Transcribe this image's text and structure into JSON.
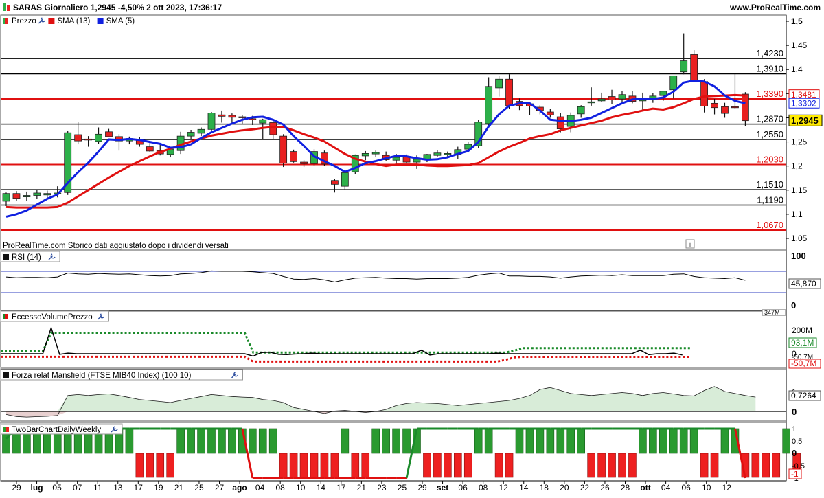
{
  "header": {
    "title": "SARAS Giornaliero 1,2945 -4,50% 2 ott 2023, 17:36:17",
    "site": "www.ProRealTime.com",
    "note": "ProRealTime.com  Storico dati aggiustato dopo i dividendi versati",
    "info_glyph": "i"
  },
  "colors": {
    "up": "#2db04a",
    "down": "#e82020",
    "sma13": "#e01010",
    "sma5": "#1020e0",
    "level_black": "#000000",
    "level_red": "#e01010",
    "mansfield_fill": "#d8ecd8",
    "mansfield_neg_fill": "#e8d0d0"
  },
  "price_panel": {
    "legend": [
      {
        "label": "Prezzo",
        "color": "#2db04a",
        "icon": "candle-icon"
      },
      {
        "label": "SMA (13)",
        "color": "#e01010",
        "icon": "wrench-icon"
      },
      {
        "label": "SMA (5)",
        "color": "#1020e0",
        "icon": "wrench-icon"
      }
    ],
    "y_ticks": [
      "1,5",
      "1,45",
      "1,4",
      "1,35",
      "1,3",
      "1,25",
      "1,2",
      "1,15",
      "1,1",
      "1,05"
    ],
    "levels": [
      {
        "value": 1.423,
        "label": "1,4230",
        "color": "black"
      },
      {
        "value": 1.391,
        "label": "1,3910",
        "color": "black"
      },
      {
        "value": 1.339,
        "label": "1,3390",
        "color": "red"
      },
      {
        "value": 1.287,
        "label": "1,2870",
        "color": "black"
      },
      {
        "value": 1.255,
        "label": "1,2550",
        "color": "black"
      },
      {
        "value": 1.203,
        "label": "1,2030",
        "color": "red"
      },
      {
        "value": 1.151,
        "label": "1,1510",
        "color": "black"
      },
      {
        "value": 1.119,
        "label": "1,1190",
        "color": "black"
      },
      {
        "value": 1.067,
        "label": "1,0670",
        "color": "red"
      }
    ],
    "badges": [
      {
        "value": 1.3481,
        "label": "1,3481",
        "kind": "sma13"
      },
      {
        "value": 1.3302,
        "label": "1,3302",
        "kind": "sma5"
      },
      {
        "value": 1.2945,
        "label": "1,2945",
        "kind": "last"
      }
    ]
  },
  "rsi_panel": {
    "legend": "RSI (14)",
    "y_ticks": [
      "100",
      "0"
    ],
    "last": "45,870"
  },
  "volume_panel": {
    "legend": "EccessoVolumePrezzo",
    "y_ticks": [
      "200M",
      "0"
    ],
    "badges": [
      "347M",
      "93,1M",
      "-50,7M",
      "-50,7M"
    ]
  },
  "mansfield_panel": {
    "legend": "Forza relat Mansfield (FTSE MIB40 Index) (100 10)",
    "y_ticks": [
      "1",
      "0"
    ],
    "last": "0,7264"
  },
  "twobar_panel": {
    "legend": "TwoBarChartDailyWeekly",
    "y_ticks": [
      "1",
      "0,5",
      "0",
      "-0,5",
      "-1"
    ],
    "last": "-1"
  },
  "x_axis": {
    "labels": [
      "29",
      "lug",
      "05",
      "07",
      "11",
      "13",
      "17",
      "19",
      "21",
      "25",
      "27",
      "ago",
      "04",
      "08",
      "10",
      "14",
      "17",
      "21",
      "23",
      "25",
      "29",
      "set",
      "06",
      "08",
      "12",
      "14",
      "18",
      "20",
      "22",
      "26",
      "28",
      "ott",
      "04",
      "06",
      "10",
      "12"
    ],
    "bold": [
      "lug",
      "ago",
      "set",
      "ott"
    ]
  },
  "chart_data": {
    "type": "candlestick",
    "title": "SARAS Giornaliero 1,2945 -4,50% 2 ott 2023, 17:36:17",
    "ylim": [
      1.03,
      1.51
    ],
    "candles": [
      [
        1.127,
        1.145,
        1.117,
        1.143
      ],
      [
        1.143,
        1.148,
        1.128,
        1.133
      ],
      [
        1.136,
        1.147,
        1.128,
        1.139
      ],
      [
        1.139,
        1.15,
        1.132,
        1.144
      ],
      [
        1.14,
        1.149,
        1.132,
        1.143
      ],
      [
        1.143,
        1.158,
        1.135,
        1.144
      ],
      [
        1.145,
        1.273,
        1.14,
        1.269
      ],
      [
        1.265,
        1.292,
        1.245,
        1.252
      ],
      [
        1.256,
        1.262,
        1.24,
        1.254
      ],
      [
        1.251,
        1.28,
        1.246,
        1.266
      ],
      [
        1.271,
        1.277,
        1.26,
        1.261
      ],
      [
        1.261,
        1.266,
        1.232,
        1.252
      ],
      [
        1.252,
        1.261,
        1.245,
        1.257
      ],
      [
        1.254,
        1.26,
        1.24,
        1.245
      ],
      [
        1.24,
        1.252,
        1.228,
        1.231
      ],
      [
        1.232,
        1.245,
        1.222,
        1.225
      ],
      [
        1.224,
        1.24,
        1.218,
        1.235
      ],
      [
        1.232,
        1.271,
        1.225,
        1.262
      ],
      [
        1.262,
        1.275,
        1.256,
        1.27
      ],
      [
        1.268,
        1.28,
        1.262,
        1.276
      ],
      [
        1.276,
        1.312,
        1.273,
        1.31
      ],
      [
        1.306,
        1.315,
        1.29,
        1.303
      ],
      [
        1.305,
        1.309,
        1.288,
        1.301
      ],
      [
        1.302,
        1.306,
        1.288,
        1.3
      ],
      [
        1.298,
        1.304,
        1.285,
        1.296
      ],
      [
        1.289,
        1.298,
        1.255,
        1.296
      ],
      [
        1.29,
        1.295,
        1.255,
        1.265
      ],
      [
        1.262,
        1.266,
        1.198,
        1.206
      ],
      [
        1.23,
        1.234,
        1.207,
        1.209
      ],
      [
        1.208,
        1.212,
        1.198,
        1.205
      ],
      [
        1.205,
        1.235,
        1.2,
        1.23
      ],
      [
        1.227,
        1.232,
        1.2,
        1.204
      ],
      [
        1.17,
        1.173,
        1.145,
        1.162
      ],
      [
        1.158,
        1.188,
        1.152,
        1.186
      ],
      [
        1.188,
        1.224,
        1.183,
        1.222
      ],
      [
        1.221,
        1.231,
        1.212,
        1.226
      ],
      [
        1.225,
        1.232,
        1.218,
        1.228
      ],
      [
        1.222,
        1.23,
        1.21,
        1.213
      ],
      [
        1.212,
        1.225,
        1.2,
        1.218
      ],
      [
        1.22,
        1.224,
        1.205,
        1.208
      ],
      [
        1.208,
        1.222,
        1.194,
        1.214
      ],
      [
        1.213,
        1.225,
        1.208,
        1.224
      ],
      [
        1.222,
        1.233,
        1.219,
        1.227
      ],
      [
        1.226,
        1.23,
        1.22,
        1.226
      ],
      [
        1.224,
        1.24,
        1.215,
        1.234
      ],
      [
        1.235,
        1.25,
        1.228,
        1.245
      ],
      [
        1.242,
        1.295,
        1.238,
        1.291
      ],
      [
        1.288,
        1.384,
        1.28,
        1.365
      ],
      [
        1.362,
        1.387,
        1.344,
        1.38
      ],
      [
        1.38,
        1.39,
        1.318,
        1.325
      ],
      [
        1.334,
        1.34,
        1.316,
        1.325
      ],
      [
        1.329,
        1.332,
        1.306,
        1.324
      ],
      [
        1.322,
        1.326,
        1.307,
        1.315
      ],
      [
        1.312,
        1.318,
        1.3,
        1.306
      ],
      [
        1.302,
        1.31,
        1.27,
        1.277
      ],
      [
        1.282,
        1.311,
        1.27,
        1.305
      ],
      [
        1.308,
        1.326,
        1.3,
        1.323
      ],
      [
        1.332,
        1.363,
        1.325,
        1.333
      ],
      [
        1.335,
        1.352,
        1.332,
        1.339
      ],
      [
        1.344,
        1.358,
        1.328,
        1.337
      ],
      [
        1.339,
        1.355,
        1.332,
        1.348
      ],
      [
        1.345,
        1.356,
        1.33,
        1.334
      ],
      [
        1.335,
        1.352,
        1.315,
        1.341
      ],
      [
        1.337,
        1.351,
        1.331,
        1.345
      ],
      [
        1.346,
        1.354,
        1.335,
        1.355
      ],
      [
        1.358,
        1.377,
        1.34,
        1.387
      ],
      [
        1.395,
        1.475,
        1.39,
        1.418
      ],
      [
        1.431,
        1.44,
        1.38,
        1.374
      ],
      [
        1.375,
        1.38,
        1.311,
        1.324
      ],
      [
        1.33,
        1.339,
        1.307,
        1.321
      ],
      [
        1.323,
        1.331,
        1.3,
        1.309
      ],
      [
        1.323,
        1.392,
        1.318,
        1.322
      ],
      [
        1.349,
        1.353,
        1.283,
        1.294
      ]
    ],
    "sma13": [
      1.115,
      1.114,
      1.114,
      1.114,
      1.114,
      1.115,
      1.124,
      1.137,
      1.15,
      1.163,
      1.176,
      1.188,
      1.2,
      1.21,
      1.22,
      1.229,
      1.236,
      1.244,
      1.251,
      1.257,
      1.263,
      1.267,
      1.271,
      1.274,
      1.276,
      1.279,
      1.281,
      1.281,
      1.274,
      1.266,
      1.259,
      1.251,
      1.238,
      1.225,
      1.215,
      1.209,
      1.204,
      1.2,
      1.203,
      1.203,
      1.203,
      1.201,
      1.2,
      1.2,
      1.201,
      1.202,
      1.206,
      1.218,
      1.23,
      1.24,
      1.248,
      1.257,
      1.262,
      1.266,
      1.274,
      1.279,
      1.284,
      1.289,
      1.294,
      1.301,
      1.306,
      1.31,
      1.315,
      1.319,
      1.317,
      1.322,
      1.33,
      1.339,
      1.344,
      1.345,
      1.346,
      1.347,
      1.346
    ],
    "sma5": [
      1.095,
      1.1,
      1.108,
      1.12,
      1.132,
      1.141,
      1.165,
      1.187,
      1.207,
      1.23,
      1.255,
      1.254,
      1.256,
      1.254,
      1.25,
      1.246,
      1.238,
      1.239,
      1.245,
      1.258,
      1.27,
      1.279,
      1.288,
      1.296,
      1.301,
      1.302,
      1.296,
      1.286,
      1.262,
      1.242,
      1.22,
      1.21,
      1.2,
      1.188,
      1.196,
      1.206,
      1.21,
      1.216,
      1.221,
      1.22,
      1.216,
      1.213,
      1.214,
      1.218,
      1.225,
      1.231,
      1.25,
      1.282,
      1.307,
      1.325,
      1.33,
      1.33,
      1.315,
      1.296,
      1.294,
      1.293,
      1.296,
      1.3,
      1.31,
      1.32,
      1.33,
      1.338,
      1.339,
      1.339,
      1.342,
      1.354,
      1.373,
      1.377,
      1.375,
      1.365,
      1.346,
      1.335,
      1.33
    ],
    "rsi": [
      0.37,
      0.35,
      0.36,
      0.36,
      0.35,
      0.37,
      0.46,
      0.44,
      0.43,
      0.45,
      0.44,
      0.43,
      0.44,
      0.42,
      0.4,
      0.39,
      0.4,
      0.44,
      0.45,
      0.47,
      0.51,
      0.5,
      0.5,
      0.5,
      0.49,
      0.47,
      0.45,
      0.38,
      0.32,
      0.31,
      0.33,
      0.3,
      0.25,
      0.3,
      0.34,
      0.35,
      0.36,
      0.34,
      0.33,
      0.33,
      0.32,
      0.33,
      0.33,
      0.33,
      0.34,
      0.36,
      0.41,
      0.44,
      0.46,
      0.39,
      0.39,
      0.38,
      0.38,
      0.37,
      0.34,
      0.37,
      0.39,
      0.4,
      0.41,
      0.4,
      0.42,
      0.4,
      0.4,
      0.4,
      0.4,
      0.43,
      0.44,
      0.38,
      0.35,
      0.34,
      0.33,
      0.35,
      0.29
    ],
    "eccesso_volume": {
      "line": [
        0,
        0,
        0,
        0,
        0,
        0,
        430,
        -10,
        10,
        0,
        0,
        0,
        0,
        0,
        0,
        0,
        0,
        0,
        0,
        0,
        0,
        0,
        0,
        0,
        0,
        0,
        0,
        0,
        0,
        0,
        -40,
        20,
        25,
        -10,
        -15,
        -5,
        0,
        10,
        0,
        0,
        0,
        0,
        0,
        0,
        0,
        0,
        0,
        0,
        0,
        0,
        60,
        -20,
        0,
        0,
        0,
        0,
        0,
        0,
        0,
        10,
        0,
        0,
        0,
        0,
        0,
        0,
        0,
        0,
        0,
        0,
        0,
        0,
        0,
        0,
        0,
        0,
        60,
        -15,
        0,
        0,
        10,
        -20
      ],
      "upper": [
        40,
        40,
        40,
        40,
        40,
        40,
        347,
        347,
        347,
        347,
        347,
        347,
        347,
        347,
        347,
        347,
        347,
        347,
        347,
        347,
        347,
        347,
        347,
        347,
        347,
        347,
        347,
        347,
        347,
        347,
        20,
        20,
        20,
        20,
        20,
        20,
        20,
        20,
        20,
        20,
        20,
        20,
        20,
        20,
        20,
        20,
        20,
        20,
        20,
        20,
        20,
        20,
        20,
        20,
        20,
        20,
        20,
        20,
        20,
        20,
        20,
        50,
        93,
        93,
        93,
        93,
        93,
        93,
        93,
        93,
        93,
        93,
        93,
        93,
        93,
        93,
        93,
        93,
        93,
        93,
        93,
        93,
        93
      ],
      "lower": [
        -50,
        -50,
        -50,
        -50,
        -50,
        -50,
        -50,
        -50,
        -50,
        -50,
        -50,
        -50,
        -50,
        -50,
        -50,
        -50,
        -50,
        -50,
        -50,
        -50,
        -50,
        -50,
        -50,
        -50,
        -50,
        -50,
        -50,
        -50,
        -50,
        -50,
        -130,
        -130,
        -130,
        -130,
        -130,
        -130,
        -130,
        -130,
        -130,
        -130,
        -130,
        -130,
        -130,
        -130,
        -130,
        -130,
        -130,
        -130,
        -130,
        -130,
        -130,
        -130,
        -130,
        -130,
        -130,
        -130,
        -130,
        -130,
        -130,
        -130,
        -100,
        -60,
        -50.7,
        -50.7,
        -50.7,
        -50.7,
        -50.7,
        -50.7,
        -50.7,
        -50.7,
        -50.7,
        -50.7,
        -50.7,
        -50.7,
        -50.7,
        -50.7,
        -50.7,
        -50.7,
        -50.7,
        -50.7,
        -50.7,
        -50.7,
        -50.7
      ]
    },
    "mansfield": [
      -0.15,
      -0.25,
      -0.28,
      -0.26,
      -0.24,
      -0.2,
      0.8,
      0.85,
      0.8,
      0.85,
      0.88,
      0.8,
      0.7,
      0.6,
      0.55,
      0.5,
      0.45,
      0.55,
      0.65,
      0.75,
      0.85,
      0.8,
      0.75,
      0.72,
      0.7,
      0.6,
      0.55,
      0.45,
      0.2,
      0.1,
      0.0,
      -0.1,
      0.02,
      0.05,
      0.0,
      -0.05,
      0.0,
      0.1,
      0.3,
      0.4,
      0.45,
      0.42,
      0.4,
      0.35,
      0.3,
      0.35,
      0.4,
      0.45,
      0.5,
      0.55,
      0.65,
      0.8,
      1.1,
      1.2,
      1.05,
      0.9,
      0.85,
      0.8,
      0.85,
      0.9,
      0.95,
      0.9,
      0.8,
      0.9,
      0.95,
      0.88,
      0.8,
      0.78,
      1.05,
      1.25,
      1.0,
      0.9,
      0.8,
      0.72
    ],
    "twobar": [
      1,
      1,
      1,
      1,
      1,
      1,
      1,
      1,
      1,
      1,
      1,
      1,
      1,
      -1,
      -1,
      -1,
      -1,
      1,
      1,
      1,
      1,
      1,
      1,
      1,
      1,
      1,
      1,
      -1,
      -1,
      -1,
      -1,
      -1,
      -1,
      1,
      -1,
      -1,
      1,
      1,
      1,
      1,
      1,
      -1,
      -1,
      -1,
      -1,
      -1,
      1,
      1,
      -1,
      -1,
      1,
      1,
      1,
      1,
      1,
      1,
      1,
      -1,
      -1,
      -1,
      -1,
      -1,
      1,
      1,
      1,
      1,
      1,
      1,
      -1,
      -1,
      1,
      1,
      -1,
      -1,
      -1,
      -1,
      1,
      -1
    ],
    "twobar_line": [
      0.6,
      1,
      1,
      1,
      1,
      1,
      1,
      1,
      1,
      1,
      1,
      1,
      1,
      1,
      1,
      1,
      1,
      1,
      1,
      1,
      1,
      1,
      1,
      1,
      -1,
      -1,
      -1,
      -1,
      -1,
      -1,
      -1,
      -1,
      -1,
      -1,
      -1,
      -1,
      -1,
      -1,
      -1,
      -1,
      1,
      1,
      1,
      1,
      1,
      1,
      1,
      1,
      1,
      1,
      1,
      1,
      1,
      1,
      1,
      1,
      1,
      1,
      1,
      1,
      1,
      1,
      1,
      1,
      1,
      1,
      1,
      1,
      1,
      1,
      1,
      1,
      -1
    ]
  }
}
